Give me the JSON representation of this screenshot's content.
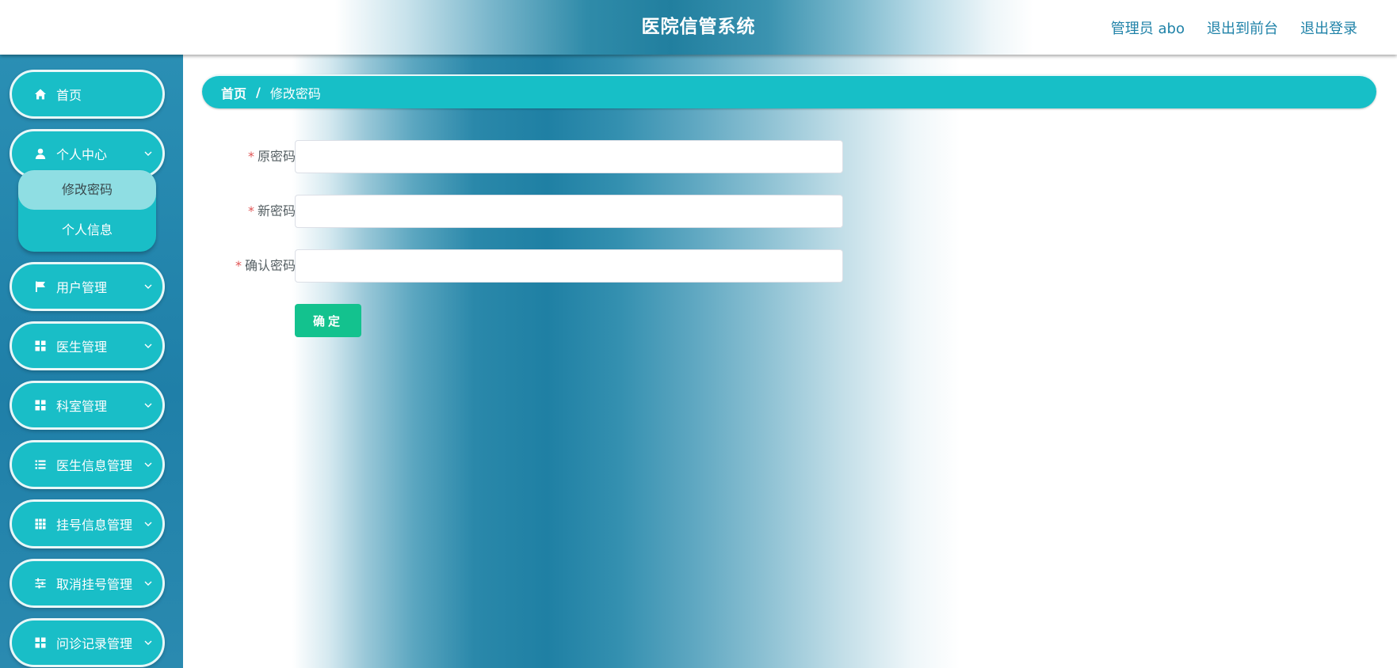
{
  "header": {
    "title": "医院信管系统",
    "links": [
      {
        "label": "管理员 abo"
      },
      {
        "label": "退出到前台"
      },
      {
        "label": "退出登录"
      }
    ]
  },
  "sidebar": {
    "items": [
      {
        "label": "首页",
        "icon": "home-icon"
      },
      {
        "label": "个人中心",
        "icon": "user-icon"
      },
      {
        "label": "用户管理",
        "icon": "flag-icon"
      },
      {
        "label": "医生管理",
        "icon": "grid-icon"
      },
      {
        "label": "科室管理",
        "icon": "grid-icon"
      },
      {
        "label": "医生信息管理",
        "icon": "list-icon"
      },
      {
        "label": "挂号信息管理",
        "icon": "grid-nine-icon"
      },
      {
        "label": "取消挂号管理",
        "icon": "sliders-icon"
      },
      {
        "label": "问诊记录管理",
        "icon": "grid-icon"
      }
    ],
    "submenu": [
      {
        "label": "修改密码",
        "active": true
      },
      {
        "label": "个人信息",
        "active": false
      }
    ]
  },
  "breadcrumb": {
    "home": "首页",
    "separator": "/",
    "current": "修改密码"
  },
  "form": {
    "required_mark": "*",
    "fields": [
      {
        "label": "原密码",
        "value": "",
        "placeholder": ""
      },
      {
        "label": "新密码",
        "value": "",
        "placeholder": ""
      },
      {
        "label": "确认密码",
        "value": "",
        "placeholder": ""
      }
    ],
    "submit_label": "确定"
  },
  "colors": {
    "accent": "#19bec7",
    "submit": "#13c28e",
    "link": "#1f82a8",
    "required": "#e05555"
  }
}
